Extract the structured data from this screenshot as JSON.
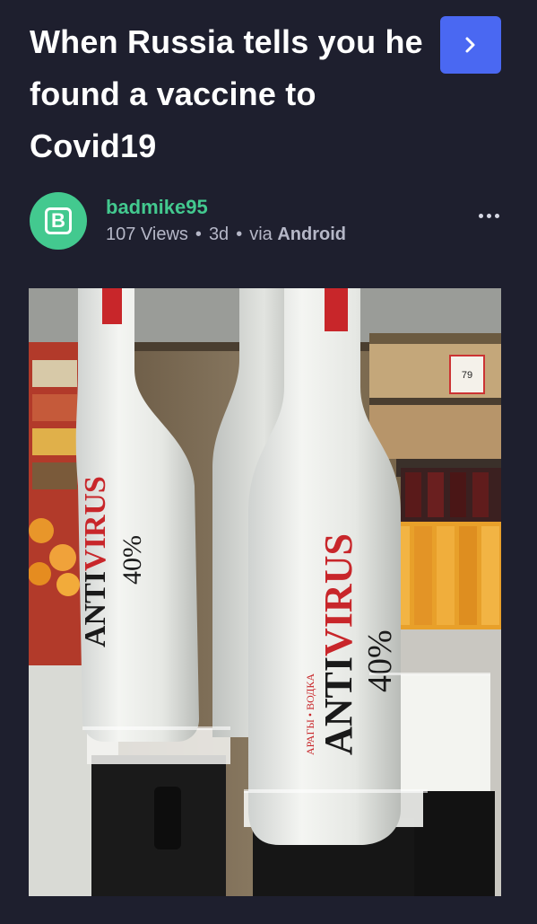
{
  "post": {
    "title": "When Russia tells you he found a vaccine to Covid19",
    "next_icon": "chevron-right-icon",
    "author": {
      "avatar_letter": "B",
      "avatar_color": "#43c98f",
      "username": "badmike95"
    },
    "meta": {
      "views": "107 Views",
      "age": "3d",
      "via_prefix": "via",
      "platform": "Android"
    },
    "more_icon": "more-dots-icon",
    "image": {
      "bottle_brand_prefix": "ANTI",
      "bottle_brand_accent": "VIRUS",
      "bottle_abv": "40%",
      "bottle_subtitle": "АРАГЫ • ВОДКА",
      "price_tag": "79"
    }
  },
  "colors": {
    "background": "#1e1f2e",
    "accent_blue": "#4a68f2",
    "accent_green": "#43c98f",
    "text_muted": "#b5b7c7"
  }
}
